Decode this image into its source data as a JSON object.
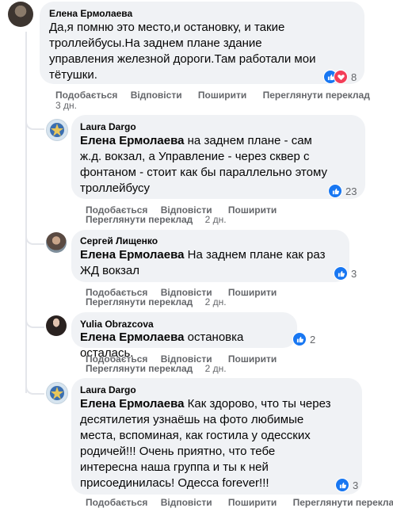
{
  "comments": [
    {
      "author": "Елена Ермолаева",
      "mention": "",
      "lines": [
        "Да,я помню это место,и остановку, и такие",
        "троллейбусы.На заднем плане здание",
        "управления железной дороги.Там работали мои",
        "тётушки."
      ],
      "reactions": "8",
      "actions": {
        "like": "Подобається",
        "reply": "Відповісти",
        "share": "Поширити",
        "translate": "Переглянути переклад",
        "time": "3 дн."
      }
    },
    {
      "author": "Laura Dargo",
      "mention": "Елена Ермолаева",
      "lines": [
        " на заднем плане - сам",
        "ж.д. вокзал, а Управление - через сквер с",
        "фонтаном - стоит как бы параллельно этому",
        "троллейбусу"
      ],
      "reactions": "23",
      "actions": {
        "like": "Подобається",
        "reply": "Відповісти",
        "share": "Поширити",
        "translate": "Переглянути переклад",
        "time": "2 дн."
      }
    },
    {
      "author": "Сергей Лищенко",
      "mention": "Елена Ермолаева",
      "lines": [
        " На заднем плане как раз",
        "ЖД вокзал"
      ],
      "reactions": "3",
      "actions": {
        "like": "Подобається",
        "reply": "Відповісти",
        "share": "Поширити",
        "translate": "Переглянути переклад",
        "time": "2 дн."
      }
    },
    {
      "author": "Yulia Obrazcova",
      "mention": "Елена Ермолаева",
      "lines": [
        " остановка осталась."
      ],
      "reactions": "2",
      "actions": {
        "like": "Подобається",
        "reply": "Відповісти",
        "share": "Поширити",
        "translate": "Переглянути переклад",
        "time": "2 дн."
      }
    },
    {
      "author": "Laura Dargo",
      "mention": "Елена Ермолаева",
      "lines": [
        " Как здорово, что ты через",
        "десятилетия узнаёшь на фото любимые",
        "места, вспоминая, как гостила у одесских",
        "родичей!!! Очень приятно, что тебе",
        "интересна наша группа и ты к ней",
        "присоединилась! Одесса forever!!!"
      ],
      "reactions": "3",
      "actions": {
        "like": "Подобається",
        "reply": "Відповісти",
        "share": "Поширити",
        "translate": "Переглянути переклад",
        "time": ""
      }
    }
  ],
  "colors": {
    "bubble": "#f0f2f5",
    "like": "#1877f2",
    "heart": "#f33e58",
    "meta": "#65676b"
  }
}
